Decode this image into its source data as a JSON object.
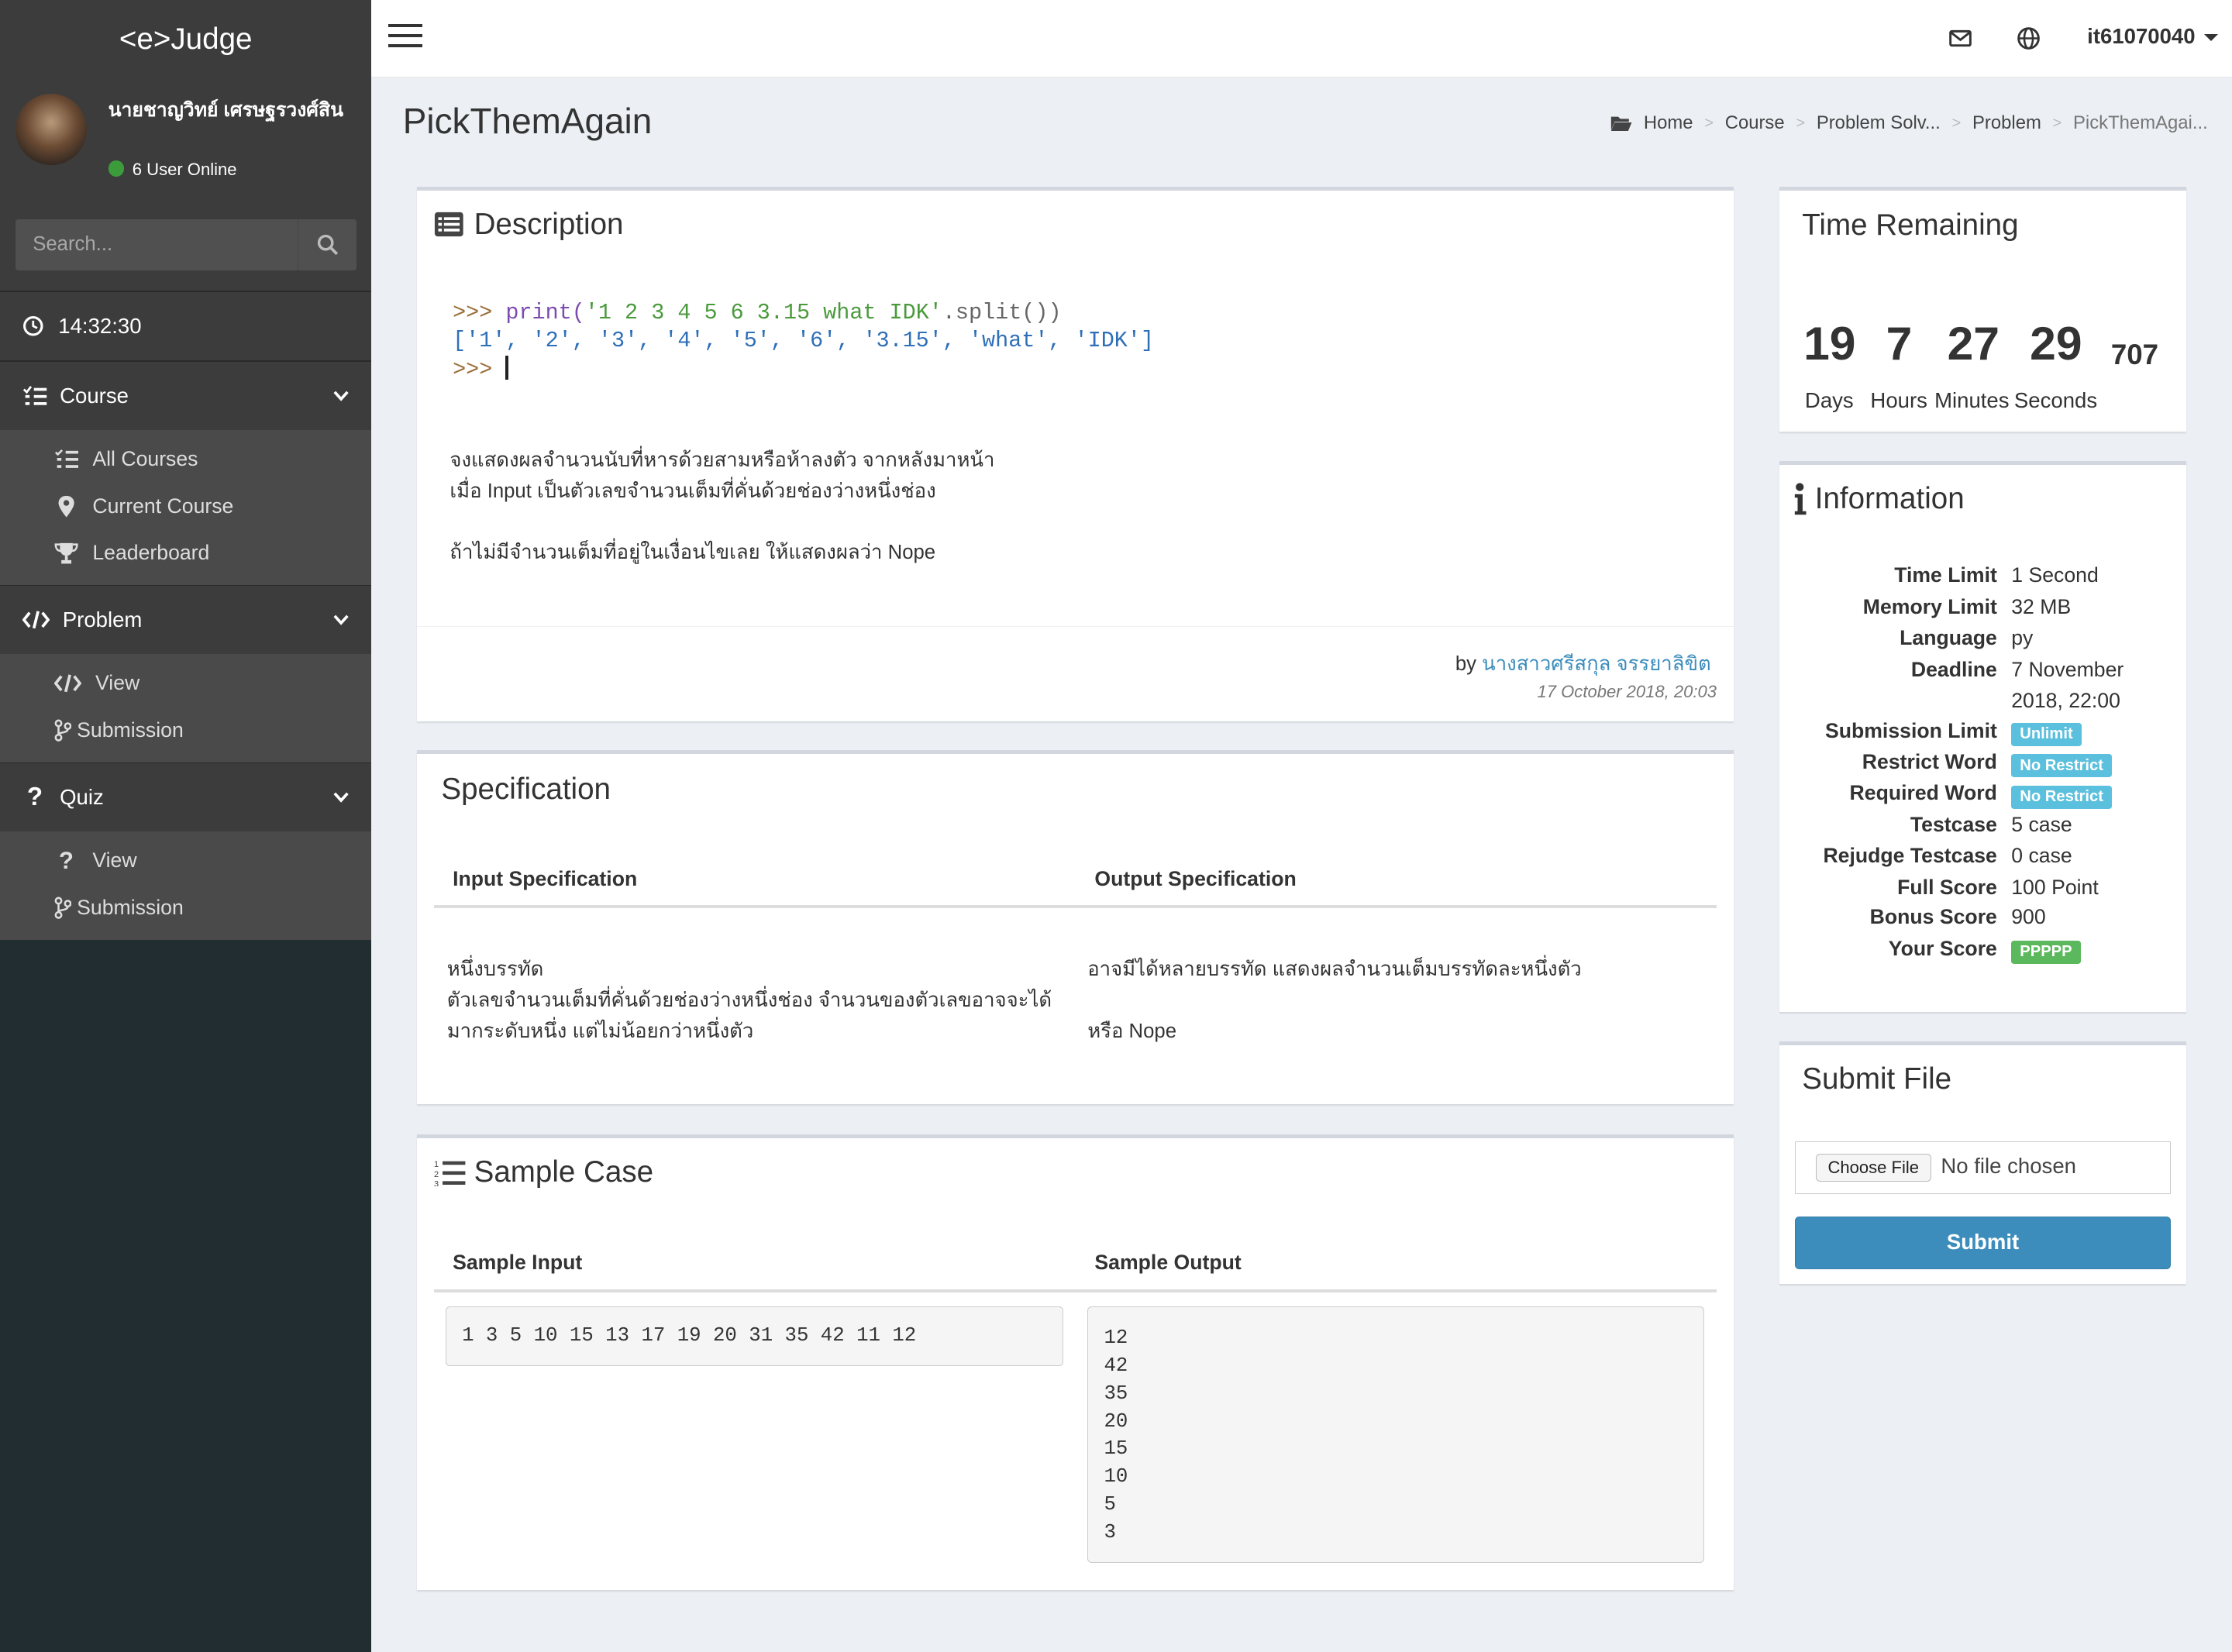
{
  "app": {
    "logo": "<e>Judge"
  },
  "user_panel": {
    "name": "นายชาญวิทย์ เศรษฐรวงศ์สิน",
    "online": "6 User Online"
  },
  "search": {
    "placeholder": "Search..."
  },
  "clock": "14:32:30",
  "sidebar": {
    "course": {
      "label": "Course",
      "items": [
        "All Courses",
        "Current Course",
        "Leaderboard"
      ]
    },
    "problem": {
      "label": "Problem",
      "items": [
        "View",
        "Submission"
      ]
    },
    "quiz": {
      "label": "Quiz",
      "items": [
        "View",
        "Submission"
      ]
    }
  },
  "topbar": {
    "username": "it61070040"
  },
  "page": {
    "title": "PickThemAgain"
  },
  "breadcrumb": [
    "Home",
    "Course",
    "Problem Solv...",
    "Problem",
    "PickThemAgai..."
  ],
  "description": {
    "title": "Description",
    "code": {
      "line1_prompt": ">>> ",
      "line1_func": "print(",
      "line1_str": "'1 2 3 4 5 6 3.15 what IDK'",
      "line1_rest": ".split())",
      "line2": "['1', '2', '3', '4', '5', '6', '3.15', 'what', 'IDK']",
      "line3_prompt": ">>> "
    },
    "text1": "จงแสดงผลจำนวนนับที่หารด้วยสามหรือห้าลงตัว จากหลังมาหน้า",
    "text2": "เมื่อ Input เป็นตัวเลขจำนวนเต็มที่คั่นด้วยช่องว่างหนึ่งช่อง",
    "text3": "ถ้าไม่มีจำนวนเต็มที่อยู่ในเงื่อนไขเลย ให้แสดงผลว่า Nope",
    "by_label": "by",
    "author": "นางสาวศรีสกุล จรรยาลิขิต",
    "date": "17 October 2018, 20:03"
  },
  "specification": {
    "title": "Specification",
    "input_header": "Input Specification",
    "output_header": "Output Specification",
    "input_lines": [
      "หนึ่งบรรทัด",
      "ตัวเลขจำนวนเต็มที่คั่นด้วยช่องว่างหนึ่งช่อง จำนวนของตัวเลขอาจจะได้",
      "มากระดับหนึ่ง แต่ไม่น้อยกว่าหนึ่งตัว"
    ],
    "output_lines": [
      "อาจมีได้หลายบรรทัด แสดงผลจำนวนเต็มบรรทัดละหนึ่งตัว",
      "หรือ Nope"
    ]
  },
  "sample": {
    "title": "Sample Case",
    "input_header": "Sample Input",
    "output_header": "Sample Output",
    "input": "1 3 5 10 15 13 17 19 20 31 35 42 11 12",
    "output": [
      "12",
      "42",
      "35",
      "20",
      "15",
      "10",
      "5",
      "3"
    ]
  },
  "time_remaining": {
    "title": "Time Remaining",
    "days": "19",
    "hours": "7",
    "minutes": "27",
    "seconds": "29",
    "ms": "707",
    "days_label": "Days",
    "hours_label": "Hours",
    "minutes_label": "Minutes",
    "seconds_label": "Seconds"
  },
  "information": {
    "title": "Information",
    "rows": [
      {
        "key": "Time Limit",
        "value": "1 Second"
      },
      {
        "key": "Memory Limit",
        "value": "32 MB"
      },
      {
        "key": "Language",
        "value": "py"
      },
      {
        "key": "Deadline",
        "value": "7 November",
        "value2": "2018, 22:00"
      },
      {
        "key": "Submission Limit",
        "badge": "Unlimit"
      },
      {
        "key": "Restrict Word",
        "badge": "No Restrict"
      },
      {
        "key": "Required Word",
        "badge": "No Restrict"
      },
      {
        "key": "Testcase",
        "value": "5 case"
      },
      {
        "key": "Rejudge Testcase",
        "value": "0 case"
      },
      {
        "key": "Full Score",
        "value": "100 Point"
      },
      {
        "key": "Bonus Score",
        "value": "900"
      },
      {
        "key": "Your Score",
        "badge": "PPPPP"
      }
    ]
  },
  "submit": {
    "title": "Submit File",
    "choose": "Choose File",
    "no_file": "No file chosen",
    "button": "Submit"
  },
  "colors": {
    "sidebar": "#3c3c3c",
    "primary": "#3c8dbc",
    "badge_info": "#5bc0de",
    "badge_success": "#5cb85c"
  }
}
